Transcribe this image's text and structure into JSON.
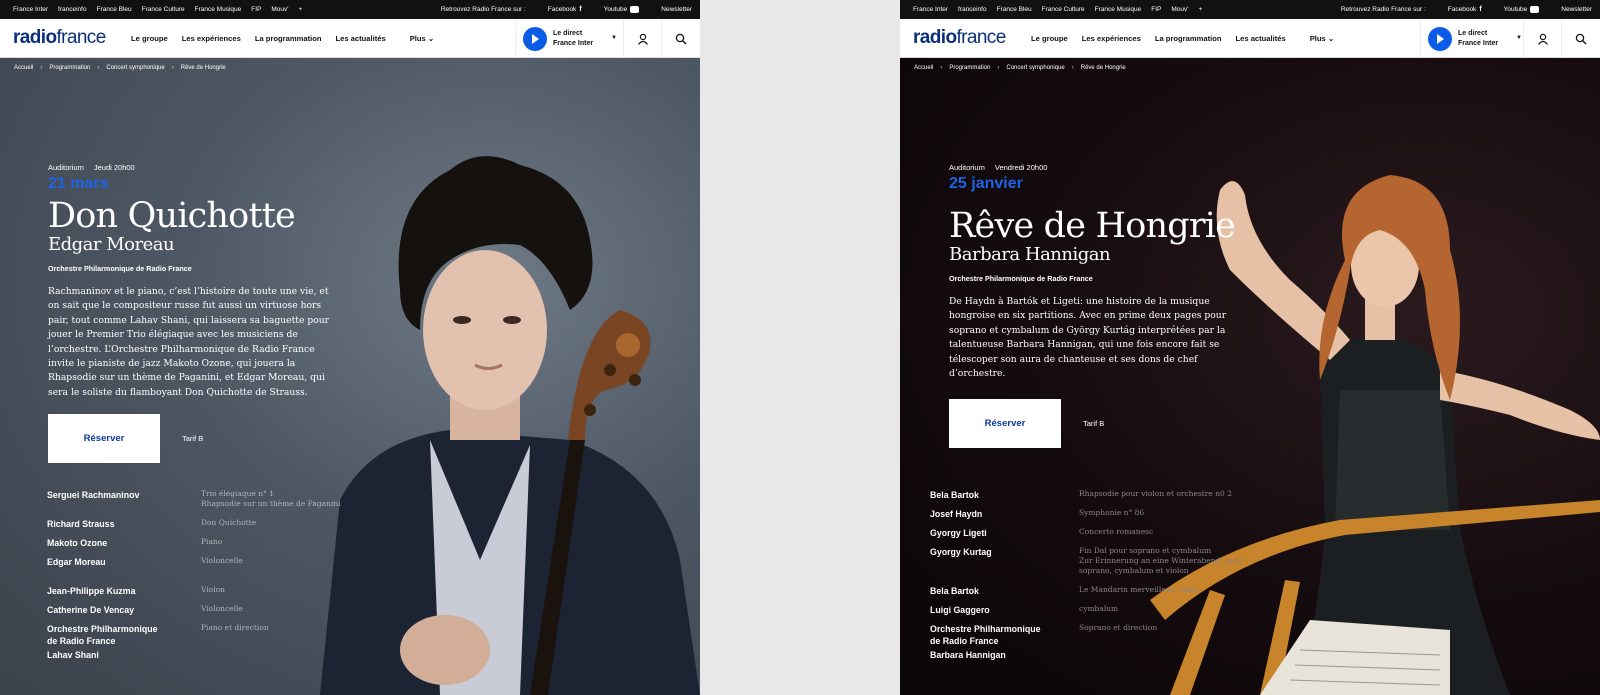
{
  "topbar": {
    "sites": [
      "France Inter",
      "franceinfo",
      "France Bleu",
      "France Culture",
      "France Musique",
      "FIP",
      "Mouv'",
      "+"
    ],
    "retrouvez": "Retrouvez Radio France sur :",
    "facebook": "Facebook",
    "youtube": "Youtube",
    "newsletter": "Newsletter"
  },
  "header": {
    "logo_bold": "radio",
    "logo_rest": "france",
    "nav": [
      "Le groupe",
      "Les expériences",
      "La programmation",
      "Les actualités"
    ],
    "more": "Plus",
    "direct_line1": "Le direct",
    "direct_line2": "France Inter"
  },
  "breadcrumb": {
    "items": [
      "Accueil",
      "Programmation",
      "Concert symphonique",
      "Rêve de Hongrie"
    ]
  },
  "concert1": {
    "venue": "Auditorium",
    "day": "Jeudi 20h00",
    "date": "21 mars",
    "title": "Don Quichotte",
    "subtitle": "Edgar Moreau",
    "orchestra": "Orchestre Philarmonique de Radio France",
    "description": "Rachmaninov et le piano, c’est l’histoire de toute une vie, et on sait que le compositeur russe fut aussi un virtuose hors pair, tout comme Lahav Shani, qui laissera sa baguette pour jouer le Premier Trio élégiaque avec les musiciens de l’orchestre. L’Orchestre Philharmonique de Radio France invite le pianiste de jazz Makoto Ozone, qui jouera la Rhapsodie sur un thème de Paganini, et Edgar Moreau, qui sera le soliste du flamboyant Don Quichotte de Strauss.",
    "reserve": "Réserver",
    "tarif": "Tarif B",
    "programme": [
      {
        "name": "Serguei Rachmaninov",
        "work": "Trio élégiaque n° 1\nRhapsodie sur un thème de Paganini"
      },
      {
        "name": "Richard Strauss",
        "work": "Don Quichotte"
      },
      {
        "name": "Makoto Ozone",
        "work": "Piano"
      },
      {
        "name": "Edgar Moreau",
        "work": "Violoncelle"
      },
      {
        "name": "Jean-Philippe Kuzma",
        "work": "Violon"
      },
      {
        "name": "Catherine De Vencay",
        "work": "Violoncelle"
      },
      {
        "name": "Orchestre Philharmonique\nde Radio France",
        "work": "Piano et direction"
      },
      {
        "name": "Lahav Shani",
        "work": ""
      }
    ]
  },
  "concert2": {
    "venue": "Auditorium",
    "day": "Vendredi 20h00",
    "date": "25 janvier",
    "title": "Rêve de Hongrie",
    "subtitle": "Barbara Hannigan",
    "orchestra": "Orchestre Philarmonique de Radio France",
    "description": "De Haydn à Bartók et Ligeti: une histoire de la musique hongroise en six partitions. Avec en prime deux pages pour soprano et cymbalum de György Kurtág interprétées par la talentueuse Barbara Hannigan, qui une fois encore fait se télescoper son aura de chanteuse et ses dons de chef d’orchestre.",
    "reserve": "Réserver",
    "tarif": "Tarif B",
    "programme": [
      {
        "name": "Bela Bartok",
        "work": "Rhapsodie pour violon et orchestre n0 2"
      },
      {
        "name": "Josef Haydn",
        "work": "Symphonie n° 86"
      },
      {
        "name": "Gyorgy Ligeti",
        "work": "Concerto romanesc"
      },
      {
        "name": "Gyorgy Kurtag",
        "work": "Fin Dal pour soprano et cymbalum\nZur Erinnerung an eine Winterabend, pour soprano, cymbalum et violon"
      },
      {
        "name": "Bela Bartok",
        "work": "Le Mandarin merveilleux, suite"
      },
      {
        "name": "Luigi Gaggero",
        "work": "cymbalum"
      },
      {
        "name": "Orchestre Philharmonique\nde Radio France",
        "work": "Soprano et direction"
      },
      {
        "name": "Barbara Hannigan",
        "work": ""
      }
    ]
  },
  "colors": {
    "brand": "#0b2f7a",
    "accent": "#1e63e6",
    "play": "#0a5be6"
  }
}
